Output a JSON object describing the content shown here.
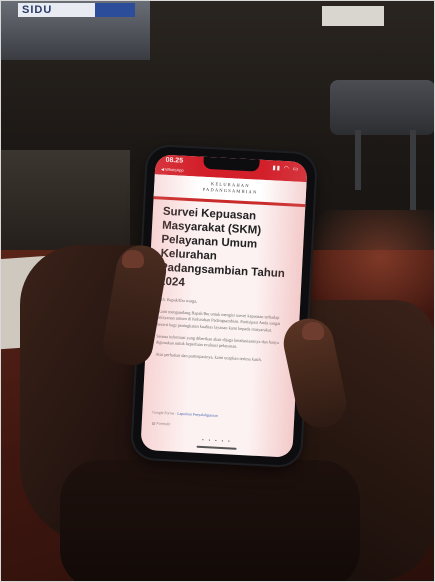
{
  "background": {
    "shelf_sign": "SIDU",
    "colors": {
      "desk": "#4a1c13",
      "phone_accent": "#d21f2a"
    }
  },
  "phone": {
    "status_time": "08.25",
    "back_label": "◀ WhatsApp",
    "status_icons": "▮▮ ◠ ▭",
    "site_name_line1": "KELURAHAN",
    "site_name_line2": "PADANGSAMBIAN",
    "doc_title": "Survei Kepuasan Masyarakat (SKM) Pelayanan Umum Kelurahan Padangsambian Tahun 2024",
    "paragraphs": [
      "Yth. Bapak/Ibu warga,",
      "Kami mengundang Bapak/Ibu untuk mengisi survei kepuasan terhadap pelayanan umum di Kelurahan Padangsambian. Partisipasi Anda sangat berarti bagi peningkatan kualitas layanan kami kepada masyarakat.",
      "Semua informasi yang diberikan akan dijaga kerahasiaannya dan hanya digunakan untuk keperluan evaluasi pelayanan.",
      "Atas perhatian dan partisipasinya, kami ucapkan terima kasih."
    ],
    "footer_prefix": "Google Forms",
    "footer_link": "Laporkan Penyalahgunaan",
    "meta": "▤  Formulir",
    "page_dots": "• • • • •"
  }
}
